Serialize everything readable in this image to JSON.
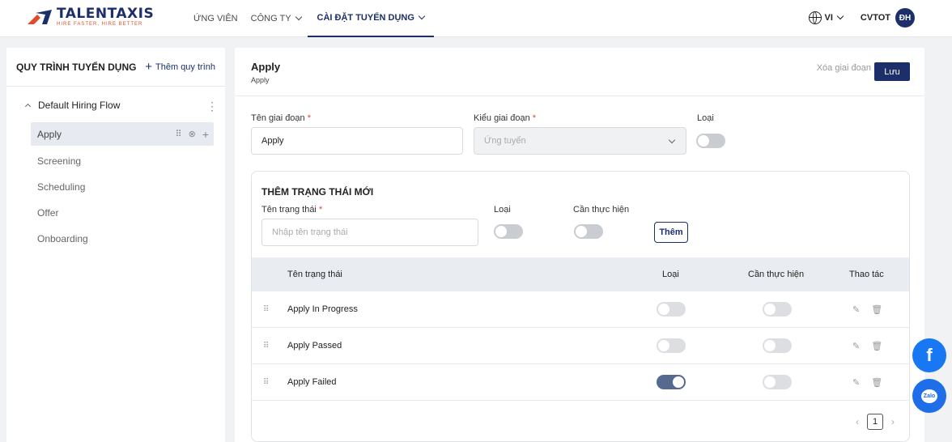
{
  "app": {
    "logo_name": "TALENTAXIS",
    "logo_tagline": "HIRE FASTER, HIRE BETTER",
    "brand_color": "#1c2f6b",
    "accent_color": "#e24a2a"
  },
  "nav": {
    "items": [
      {
        "label": "ỨNG VIÊN",
        "has_dropdown": false
      },
      {
        "label": "CÔNG TY",
        "has_dropdown": true
      },
      {
        "label": "CÀI ĐẶT TUYỂN DỤNG",
        "has_dropdown": true,
        "active": true
      }
    ],
    "language": "VI",
    "user_name": "CVTOT",
    "avatar_initials": "ĐH"
  },
  "sidebar": {
    "title": "QUY TRÌNH TUYỂN DỤNG",
    "add_label": "Thêm quy trình",
    "flow_name": "Default Hiring Flow",
    "stages": [
      "Apply",
      "Screening",
      "Scheduling",
      "Offer",
      "Onboarding"
    ],
    "active_stage": "Apply"
  },
  "main": {
    "title": "Apply",
    "subtitle": "Apply",
    "delete_label": "Xóa giai đoạn",
    "save_label": "Lưu",
    "form": {
      "stage_name_label": "Tên giai đoạn",
      "stage_name_value": "Apply",
      "stage_type_label": "Kiểu giai đoạn",
      "stage_type_value": "Ứng tuyển",
      "type_label": "Loại",
      "type_on": false
    },
    "new_status": {
      "title": "THÊM TRẠNG THÁI MỚI",
      "name_label": "Tên trạng thái",
      "name_placeholder": "Nhập tên trạng thái",
      "type_label": "Loại",
      "action_required_label": "Cần thực hiện",
      "add_button": "Thêm"
    },
    "table": {
      "columns": [
        "Tên trạng thái",
        "Loại",
        "Cần thực hiện",
        "Thao tác"
      ],
      "rows": [
        {
          "name": "Apply In Progress",
          "type_on": false,
          "action_required_on": false
        },
        {
          "name": "Apply Passed",
          "type_on": false,
          "action_required_on": false
        },
        {
          "name": "Apply Failed",
          "type_on": true,
          "action_required_on": false
        }
      ]
    },
    "pagination": {
      "current_page": "1"
    }
  },
  "floating": {
    "facebook_icon": "facebook-icon",
    "zalo_label": "Zalo"
  }
}
